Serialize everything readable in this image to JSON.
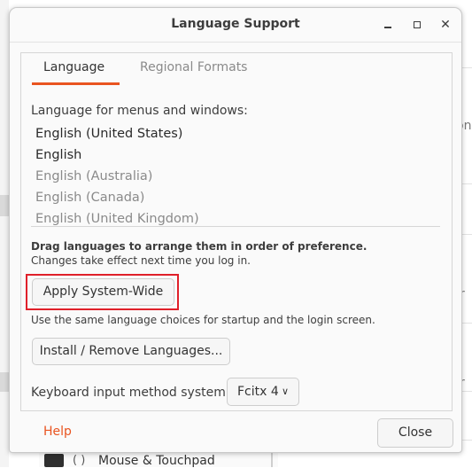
{
  "background": {
    "fragments": [
      "on",
      "r",
      "r"
    ],
    "bottom_item_label": "Mouse & Touchpad"
  },
  "window": {
    "title": "Language Support"
  },
  "tabs": [
    {
      "label": "Language",
      "active": true
    },
    {
      "label": "Regional Formats",
      "active": false
    }
  ],
  "language": {
    "section_label": "Language for menus and windows:",
    "items": [
      {
        "label": "English (United States)",
        "active": true
      },
      {
        "label": "English",
        "active": true
      },
      {
        "label": "English (Australia)",
        "active": false
      },
      {
        "label": "English (Canada)",
        "active": false
      },
      {
        "label": "English (United Kingdom)",
        "active": false
      }
    ],
    "drag_note_bold": "Drag languages to arrange them in order of preference.",
    "drag_note": "Changes take effect next time you log in.",
    "apply_button": "Apply System-Wide",
    "apply_note": "Use the same language choices for startup and the login screen.",
    "install_button": "Install / Remove Languages...",
    "keyboard_label": "Keyboard input method system:",
    "keyboard_value": "Fcitx 4"
  },
  "footer": {
    "help": "Help",
    "close": "Close"
  },
  "colors": {
    "accent": "#e95420",
    "highlight": "#e0202a"
  }
}
